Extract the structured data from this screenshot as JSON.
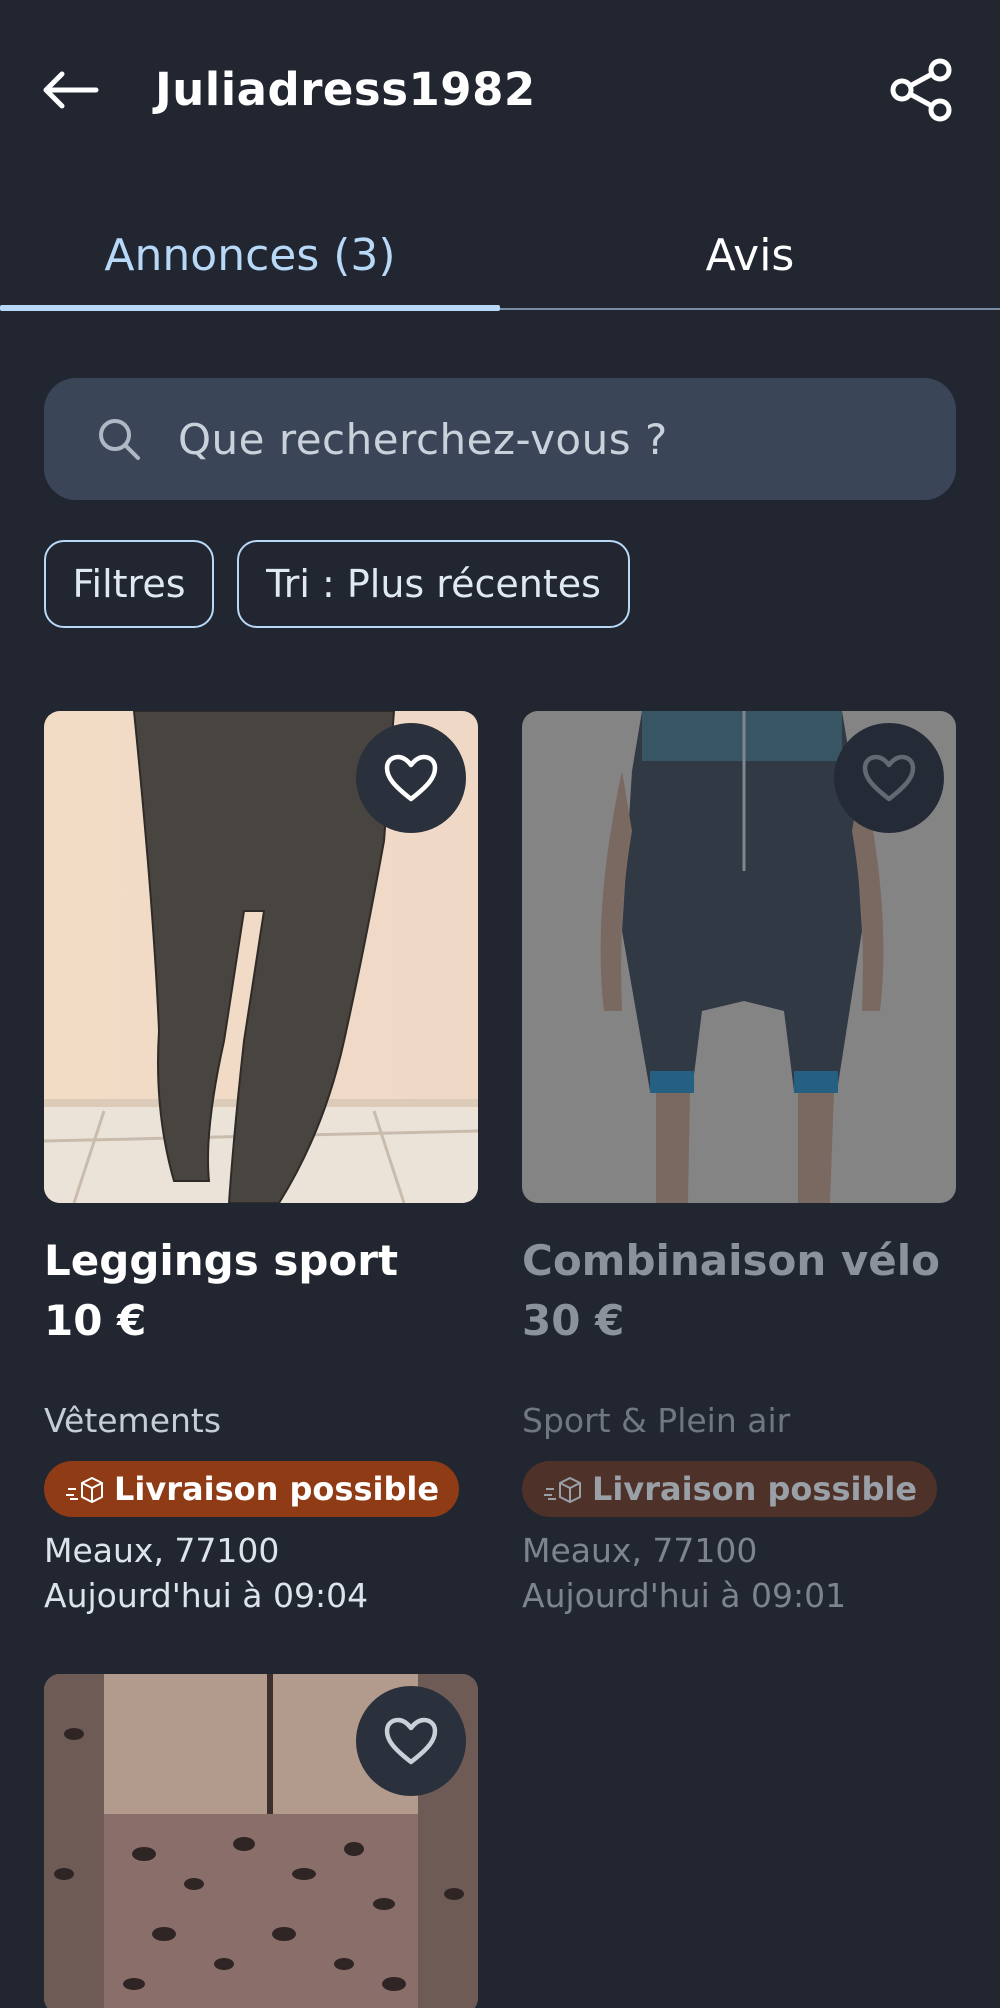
{
  "header": {
    "title": "Juliadress1982",
    "back_icon": "arrow-left-icon",
    "share_icon": "share-icon"
  },
  "tabs": [
    {
      "label": "Annonces (3)",
      "active": true
    },
    {
      "label": "Avis",
      "active": false
    }
  ],
  "search": {
    "placeholder": "Que recherchez-vous ?",
    "value": ""
  },
  "chips": {
    "filters_label": "Filtres",
    "sort_label": "Tri : Plus récentes"
  },
  "listings": [
    {
      "title": "Leggings sport",
      "price": "10 €",
      "category": "Vêtements",
      "badge": "Livraison possible",
      "location": "Meaux, 77100",
      "date": "Aujourd'hui à 09:04",
      "faded": false
    },
    {
      "title": "Combinaison vélo",
      "price": "30 €",
      "category": "Sport & Plein air",
      "badge": "Livraison possible",
      "location": "Meaux, 77100",
      "date": "Aujourd'hui à 09:01",
      "faded": true
    },
    {
      "title": "",
      "price": "",
      "category": "",
      "badge": "",
      "location": "",
      "date": "",
      "faded": false
    }
  ],
  "colors": {
    "background": "#212630",
    "accent": "#b8d8f7",
    "search_bg": "#3a4658",
    "badge_bg": "#8e3b16"
  }
}
